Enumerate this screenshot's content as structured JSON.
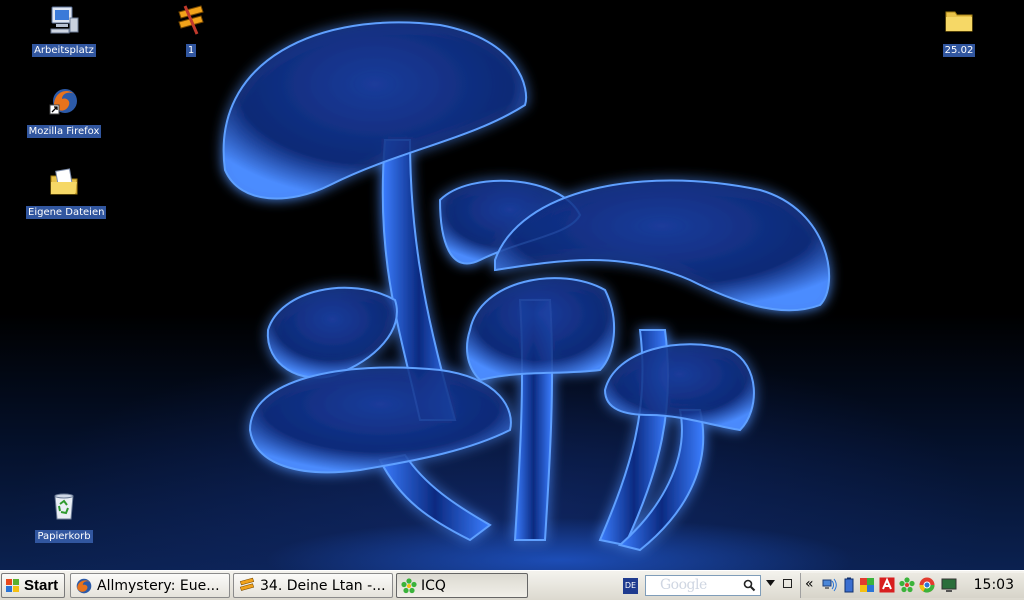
{
  "desktop": {
    "icons": [
      {
        "label": "Arbeitsplatz",
        "icon": "my-computer-icon"
      },
      {
        "label": "1",
        "icon": "winamp-icon"
      },
      {
        "label": "25.02",
        "icon": "folder-icon"
      },
      {
        "label": "Mozilla Firefox",
        "icon": "firefox-icon"
      },
      {
        "label": "Eigene Dateien",
        "icon": "my-documents-icon"
      },
      {
        "label": "Papierkorb",
        "icon": "recycle-bin-icon"
      }
    ],
    "wallpaper": "glowing-blue-mushrooms"
  },
  "taskbar": {
    "start_label": "Start",
    "tasks": [
      {
        "label": "Allmystery: Eue...",
        "icon": "firefox-icon"
      },
      {
        "label": "34. Deine Ltan -...",
        "icon": "winamp-icon"
      },
      {
        "label": "ICQ",
        "icon": "icq-flower-icon"
      }
    ],
    "language": "DE",
    "search_placeholder": "Google",
    "tray_expand": "«",
    "tray_icons": [
      "network-icon",
      "battery-icon",
      "puzzle-icon",
      "antivir-icon",
      "icq-flower-icon",
      "chrome-icon",
      "monitor-icon"
    ],
    "clock": "15:03"
  },
  "colors": {
    "icon_label_bg": "#31569f",
    "taskbar_bg": "#e9e7df",
    "glow": "#2f6bff"
  }
}
